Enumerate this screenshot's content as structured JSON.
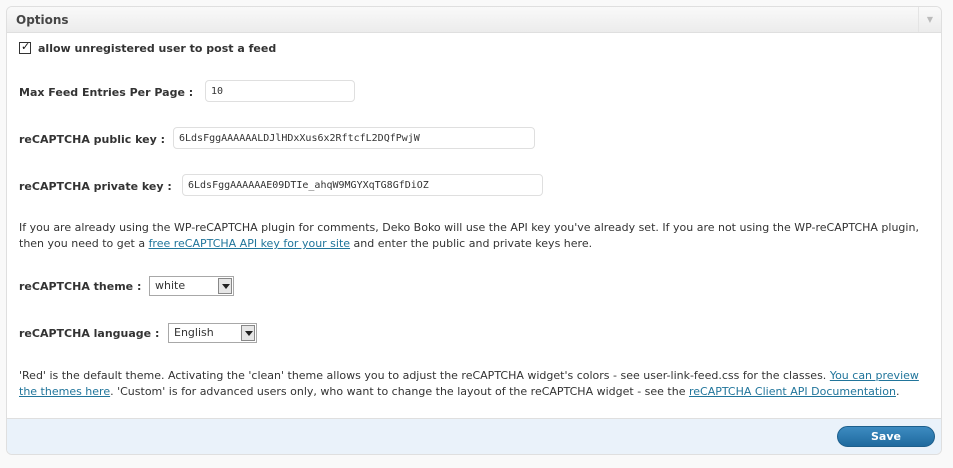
{
  "box": {
    "title": "Options",
    "toggle_glyph": "▼"
  },
  "allow_unregistered": {
    "label": "allow unregistered user to post a feed",
    "checked": true,
    "check_glyph": "✓"
  },
  "max_feed": {
    "label": "Max Feed Entries Per Page :",
    "value": "10"
  },
  "public_key": {
    "label": "reCAPTCHA public key :",
    "value": "6LdsFggAAAAAALDJlHDxXus6x2RftcfL2DQfPwjW"
  },
  "private_key": {
    "label": "reCAPTCHA private key :",
    "value": "6LdsFggAAAAAAE09DTIe_ahqW9MGYXqTG8GfDiOZ"
  },
  "api_note": {
    "before": "If you are already using the WP-reCAPTCHA plugin for comments, Deko Boko will use the API key you've already set. If you are not using the WP-reCAPTCHA plugin, then you need to get a ",
    "link": "free reCAPTCHA API key for your site",
    "after": " and enter the public and private keys here."
  },
  "theme": {
    "label": "reCAPTCHA theme :",
    "selected": "white"
  },
  "language": {
    "label": "reCAPTCHA language :",
    "selected": "English"
  },
  "theme_note": {
    "before": "'Red' is the default theme. Activating the 'clean' theme allows you to adjust the reCAPTCHA widget's colors - see user-link-feed.css for the classes. ",
    "link1": "You can preview the themes here",
    "middle": ". 'Custom' is for advanced users only, who want to change the layout of the reCAPTCHA widget - see the ",
    "link2": "reCAPTCHA Client API Documentation",
    "after": "."
  },
  "save_label": "Save"
}
